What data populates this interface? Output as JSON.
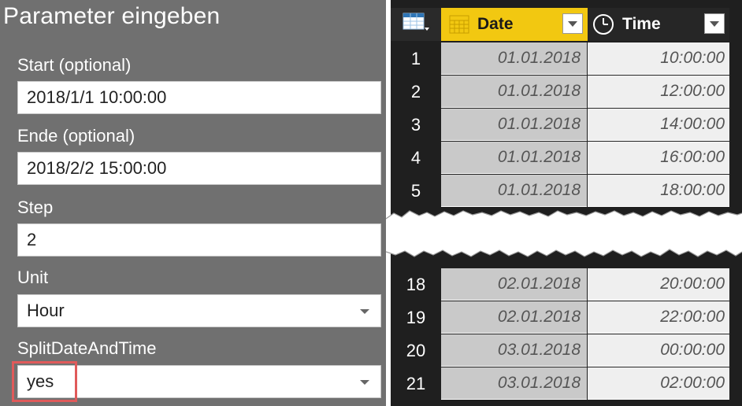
{
  "dialog": {
    "title": "Parameter eingeben",
    "fields": [
      {
        "label": "Start (optional)",
        "value": "2018/1/1 10:00:00"
      },
      {
        "label": "Ende (optional)",
        "value": "2018/2/2 15:00:00"
      },
      {
        "label": "Step",
        "value": "2"
      },
      {
        "label": "Unit",
        "value": "Hour"
      },
      {
        "label": "SplitDateAndTime",
        "value": "yes"
      }
    ]
  },
  "table": {
    "columns": [
      {
        "name": "Date",
        "icon": "calendar-icon"
      },
      {
        "name": "Time",
        "icon": "clock-icon"
      }
    ],
    "rows": [
      {
        "n": "1",
        "date": "01.01.2018",
        "time": "10:00:00"
      },
      {
        "n": "2",
        "date": "01.01.2018",
        "time": "12:00:00"
      },
      {
        "n": "3",
        "date": "01.01.2018",
        "time": "14:00:00"
      },
      {
        "n": "4",
        "date": "01.01.2018",
        "time": "16:00:00"
      },
      {
        "n": "5",
        "date": "01.01.2018",
        "time": "18:00:00"
      },
      {
        "n": "18",
        "date": "02.01.2018",
        "time": "20:00:00"
      },
      {
        "n": "19",
        "date": "02.01.2018",
        "time": "22:00:00"
      },
      {
        "n": "20",
        "date": "03.01.2018",
        "time": "00:00:00"
      },
      {
        "n": "21",
        "date": "03.01.2018",
        "time": "02:00:00"
      }
    ]
  },
  "colors": {
    "panel_bg": "#707070",
    "date_header": "#f2c811",
    "highlight": "#e05a5a"
  }
}
